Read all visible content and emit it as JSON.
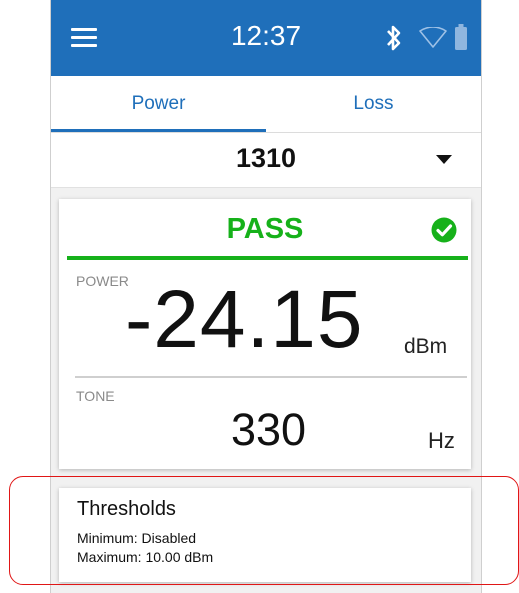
{
  "status_bar": {
    "time": "12:37",
    "icons": [
      "bluetooth-icon",
      "wifi-icon",
      "battery-icon"
    ]
  },
  "tabs": [
    {
      "label": "Power",
      "active": true
    },
    {
      "label": "Loss",
      "active": false
    }
  ],
  "wavelength": {
    "value": "1310"
  },
  "result": {
    "status": "PASS",
    "power_label": "POWER",
    "power_value": "-24.15",
    "power_unit": "dBm",
    "tone_label": "TONE",
    "tone_value": "330",
    "tone_unit": "Hz"
  },
  "thresholds": {
    "title": "Thresholds",
    "minimum": "Minimum: Disabled",
    "maximum": "Maximum: 10.00 dBm"
  },
  "colors": {
    "accent": "#1f6fba",
    "pass": "#16b11a",
    "highlight": "#e01616"
  }
}
